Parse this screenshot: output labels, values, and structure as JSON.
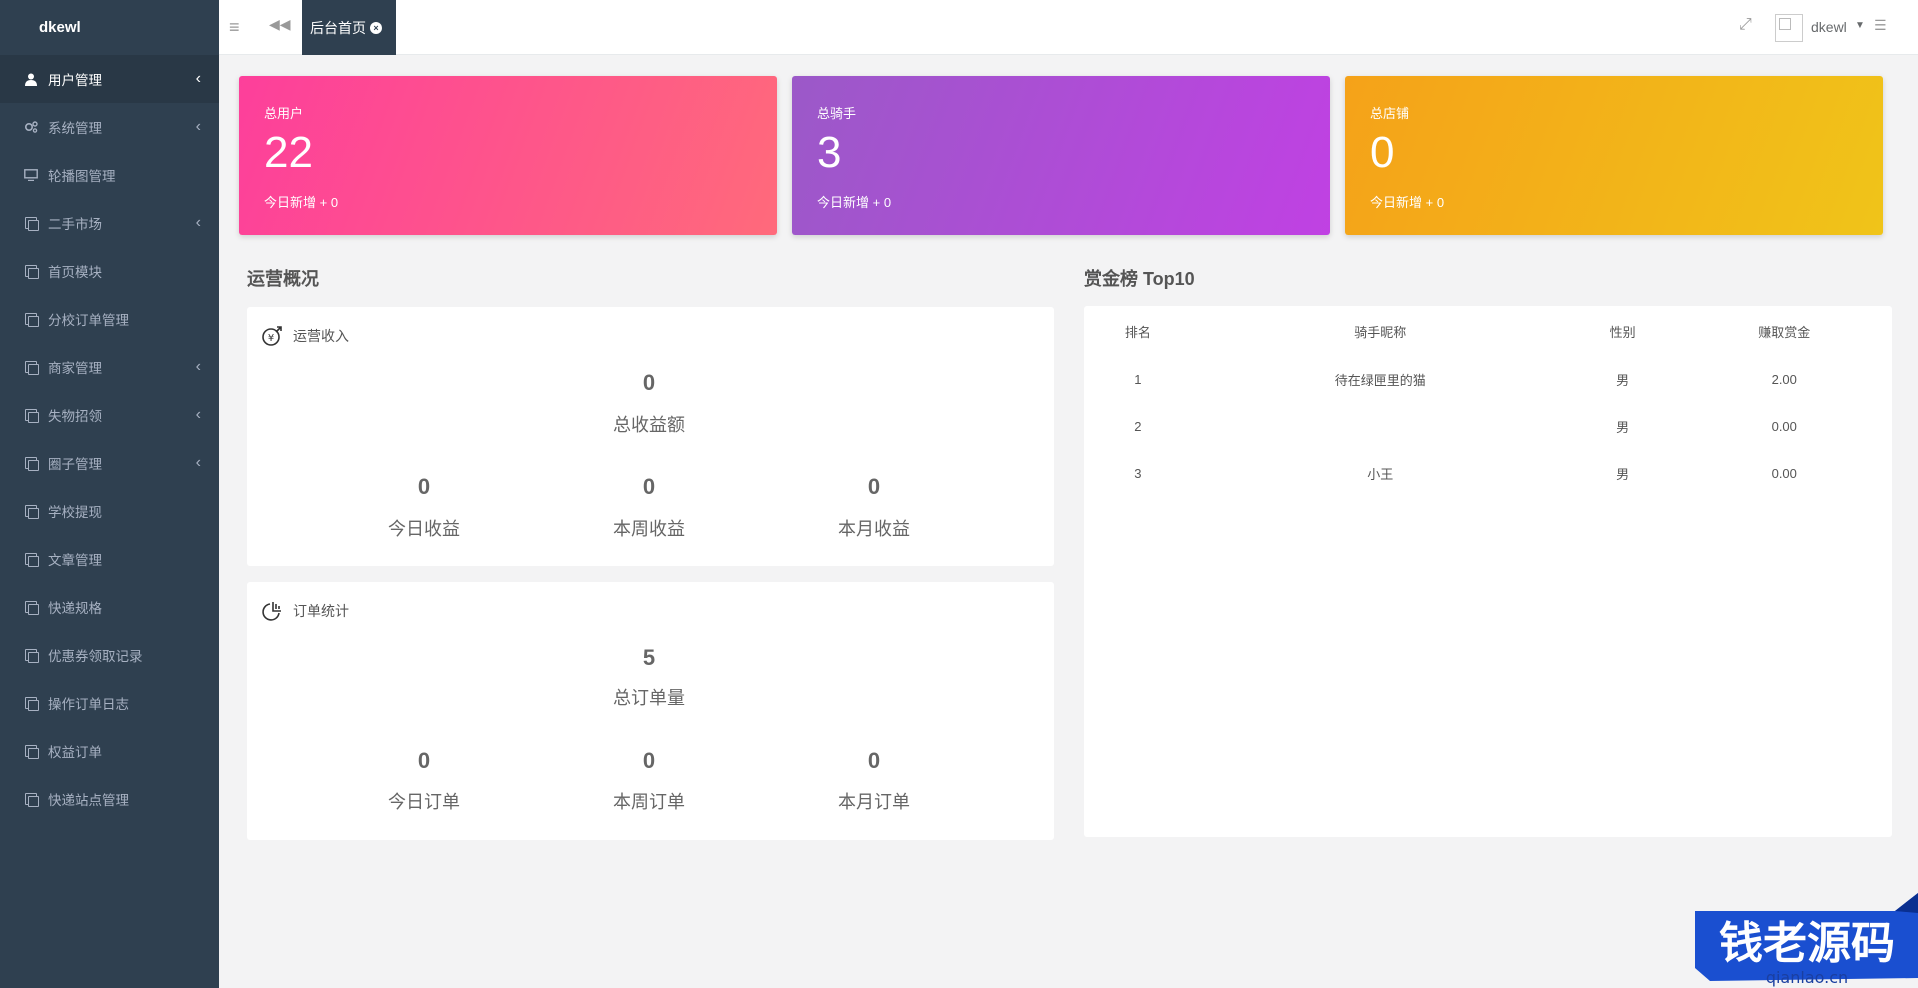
{
  "brand": "dkewl",
  "sidebar": {
    "items": [
      {
        "label": "用户管理",
        "chevron": true,
        "active": true
      },
      {
        "label": "系统管理",
        "chevron": true
      },
      {
        "label": "轮播图管理",
        "chevron": false
      },
      {
        "label": "二手市场",
        "chevron": true
      },
      {
        "label": "首页模块",
        "chevron": false
      },
      {
        "label": "分校订单管理",
        "chevron": false
      },
      {
        "label": "商家管理",
        "chevron": true
      },
      {
        "label": "失物招领",
        "chevron": true
      },
      {
        "label": "圈子管理",
        "chevron": true
      },
      {
        "label": "学校提现",
        "chevron": false
      },
      {
        "label": "文章管理",
        "chevron": false
      },
      {
        "label": "快递规格",
        "chevron": false
      },
      {
        "label": "优惠券领取记录",
        "chevron": false
      },
      {
        "label": "操作订单日志",
        "chevron": false
      },
      {
        "label": "权益订单",
        "chevron": false
      },
      {
        "label": "快递站点管理",
        "chevron": false
      }
    ]
  },
  "topbar": {
    "tab_label": "后台首页",
    "user_name": "dkewl"
  },
  "cards": {
    "users": {
      "title": "总用户",
      "value": "22",
      "sub": "今日新增 + 0"
    },
    "riders": {
      "title": "总骑手",
      "value": "3",
      "sub": "今日新增 + 0"
    },
    "shops": {
      "title": "总店铺",
      "value": "0",
      "sub": "今日新增 + 0"
    }
  },
  "overview": {
    "title": "运营概况",
    "income": {
      "heading": "运营收入",
      "total_value": "0",
      "total_label": "总收益额",
      "today_value": "0",
      "today_label": "今日收益",
      "week_value": "0",
      "week_label": "本周收益",
      "month_value": "0",
      "month_label": "本月收益"
    },
    "orders": {
      "heading": "订单统计",
      "total_value": "5",
      "total_label": "总订单量",
      "today_value": "0",
      "today_label": "今日订单",
      "week_value": "0",
      "week_label": "本周订单",
      "month_value": "0",
      "month_label": "本月订单"
    }
  },
  "ranking": {
    "title": "赏金榜 Top10",
    "columns": [
      "排名",
      "骑手昵称",
      "性别",
      "赚取赏金"
    ],
    "rows": [
      [
        "1",
        "待在绿匣里的猫",
        "男",
        "2.00"
      ],
      [
        "2",
        "",
        "男",
        "0.00"
      ],
      [
        "3",
        "小王",
        "男",
        "0.00"
      ]
    ]
  },
  "watermark": {
    "text": "钱老源码",
    "url": "qianlao.cn"
  }
}
